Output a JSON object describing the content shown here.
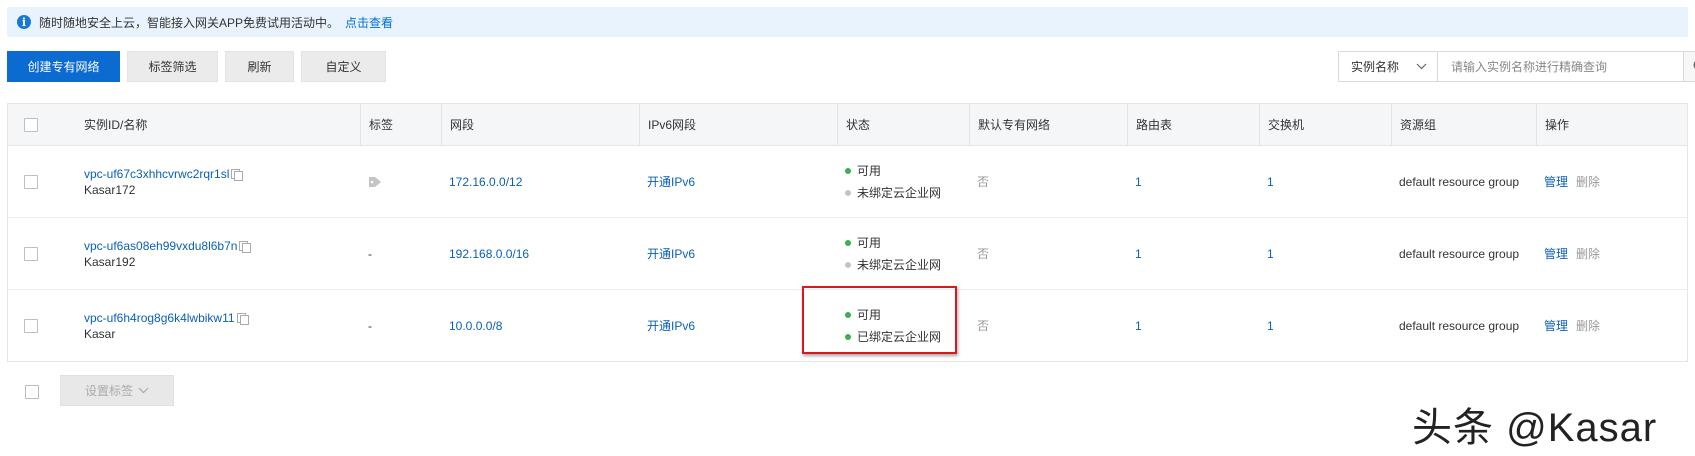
{
  "banner": {
    "text": "随时随地安全上云，智能接入网关APP免费试用活动中。",
    "link": "点击查看",
    "icon": "info-icon"
  },
  "toolbar": {
    "create_label": "创建专有网络",
    "tag_filter_label": "标签筛选",
    "refresh_label": "刷新",
    "customize_label": "自定义"
  },
  "search": {
    "field_label": "实例名称",
    "placeholder": "请输入实例名称进行精确查询"
  },
  "table": {
    "headers": {
      "id_name": "实例ID/名称",
      "tags": "标签",
      "cidr": "网段",
      "ipv6": "IPv6网段",
      "status": "状态",
      "default_vpc": "默认专有网络",
      "route_table": "路由表",
      "vswitch": "交换机",
      "resource_group": "资源组",
      "actions": "操作"
    },
    "rows": [
      {
        "id": "vpc-uf67c3xhhcvrwc2rqr1sl",
        "name": "Kasar172",
        "tags": "",
        "cidr": "172.16.0.0/12",
        "ipv6": "开通IPv6",
        "status": "可用",
        "cen": "未绑定云企业网",
        "cen_bound": false,
        "default_vpc": "否",
        "route_table": "1",
        "vswitch": "1",
        "resource_group": "default resource group",
        "manage": "管理",
        "delete": "删除"
      },
      {
        "id": "vpc-uf6as08eh99vxdu8l6b7n",
        "name": "Kasar192",
        "tags": "-",
        "cidr": "192.168.0.0/16",
        "ipv6": "开通IPv6",
        "status": "可用",
        "cen": "未绑定云企业网",
        "cen_bound": false,
        "default_vpc": "否",
        "route_table": "1",
        "vswitch": "1",
        "resource_group": "default resource group",
        "manage": "管理",
        "delete": "删除"
      },
      {
        "id": "vpc-uf6h4rog8g6k4lwbikw11",
        "name": "Kasar",
        "tags": "-",
        "cidr": "10.0.0.0/8",
        "ipv6": "开通IPv6",
        "status": "可用",
        "cen": "已绑定云企业网",
        "cen_bound": true,
        "default_vpc": "否",
        "route_table": "1",
        "vswitch": "1",
        "resource_group": "default resource group",
        "manage": "管理",
        "delete": "删除"
      }
    ]
  },
  "footer": {
    "set_tags_label": "设置标签"
  },
  "watermark": "头条 @Kasar",
  "colors": {
    "primary": "#0b6bd1",
    "link": "#0b5fb7",
    "status_ok": "#3fae4b",
    "status_unbound": "#c0c4cc",
    "highlight": "#d9191c"
  }
}
